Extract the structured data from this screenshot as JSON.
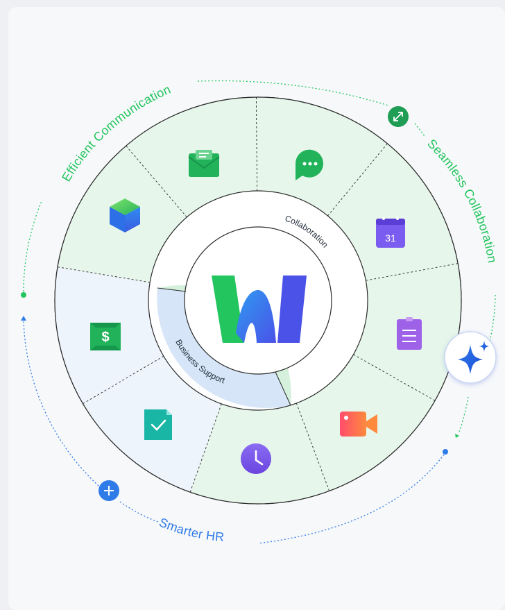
{
  "arcs": {
    "top_left": "Efficient Communication",
    "right": "Seamless Collaboration",
    "bottom": "Smarter HR"
  },
  "ring": {
    "collaboration": "Collaboration",
    "business_support": "Business Support"
  },
  "calendar_day": "31",
  "payroll_symbol": "$",
  "icons": [
    "cube-icon",
    "mail-icon",
    "chat-icon",
    "calendar-icon",
    "notes-icon",
    "video-icon",
    "clock-icon",
    "approval-icon",
    "payroll-icon"
  ],
  "colors": {
    "green": "#22c55e",
    "blue": "#2f7be8",
    "collab_sector": "#e6f6ea",
    "support_sector": "#eef4fc",
    "collab_ring": "#d5f0dc",
    "support_ring": "#d6e5f7"
  }
}
